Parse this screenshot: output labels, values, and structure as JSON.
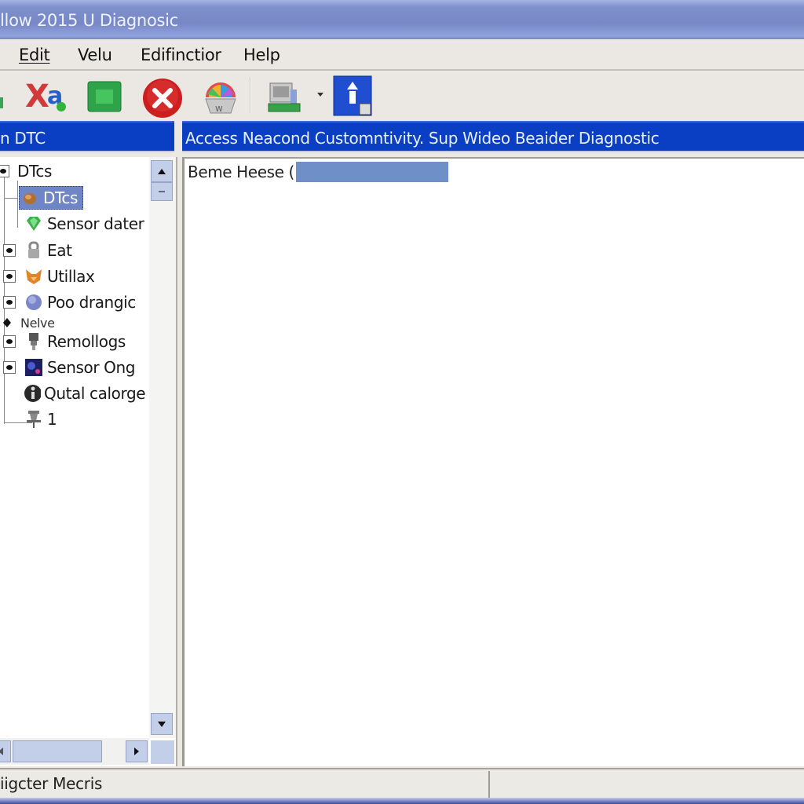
{
  "window": {
    "title": "llow 2015 U Diagnosic",
    "colors": {
      "titlebar": "#7b8bc8",
      "panel_header": "#0a3fc4",
      "selection": "#6e86c5",
      "highlight": "#6f8fc8"
    }
  },
  "menu": {
    "items": [
      {
        "label": "Edit",
        "accel": "E"
      },
      {
        "label": "Velu",
        "accel": "V"
      },
      {
        "label": "Edifinctior",
        "accel": "E"
      },
      {
        "label": "Help",
        "accel": "H"
      }
    ]
  },
  "toolbar": {
    "buttons": [
      {
        "icon": "partial-green-icon"
      },
      {
        "icon": "find-replace-icon"
      },
      {
        "icon": "green-module-icon"
      },
      {
        "icon": "stop-icon"
      },
      {
        "icon": "color-palette-icon"
      },
      {
        "icon": "computer-icon",
        "has_dropdown": true
      },
      {
        "icon": "info-icon"
      }
    ]
  },
  "left_panel": {
    "header": "n DTC",
    "tree": [
      {
        "label": "DTcs",
        "icon": "expander",
        "level": 0,
        "expanded": true
      },
      {
        "label": "DTcs",
        "icon": "dtc-icon",
        "level": 1,
        "selected": true
      },
      {
        "label": "Sensor dater",
        "icon": "green-gem-icon",
        "level": 1
      },
      {
        "label": "Eat",
        "icon": "lock-icon",
        "level": 1,
        "expandable": true
      },
      {
        "label": "Utillax",
        "icon": "fox-icon",
        "level": 1,
        "expandable": true
      },
      {
        "label": "Poo drangic",
        "icon": "globe-icon",
        "level": 1,
        "expandable": true
      },
      {
        "label": "Nelve",
        "icon": "diamond-icon",
        "level": 0
      },
      {
        "label": "Remollogs",
        "icon": "plug-icon",
        "level": 1,
        "expandable": true
      },
      {
        "label": "Sensor Ong",
        "icon": "image-icon",
        "level": 1,
        "expandable": true
      },
      {
        "label": "Qutal calorge",
        "icon": "info-circle-icon",
        "level": 1
      },
      {
        "label": "1",
        "icon": "pin-icon",
        "level": 1
      }
    ]
  },
  "right_panel": {
    "header": "Access Neacond Customntivity. Sup Wideo Beaider Diagnostic",
    "content_text": "Beme Heese ("
  },
  "status_bar": {
    "left_text": "iigcter Mecris",
    "right_text": ""
  }
}
